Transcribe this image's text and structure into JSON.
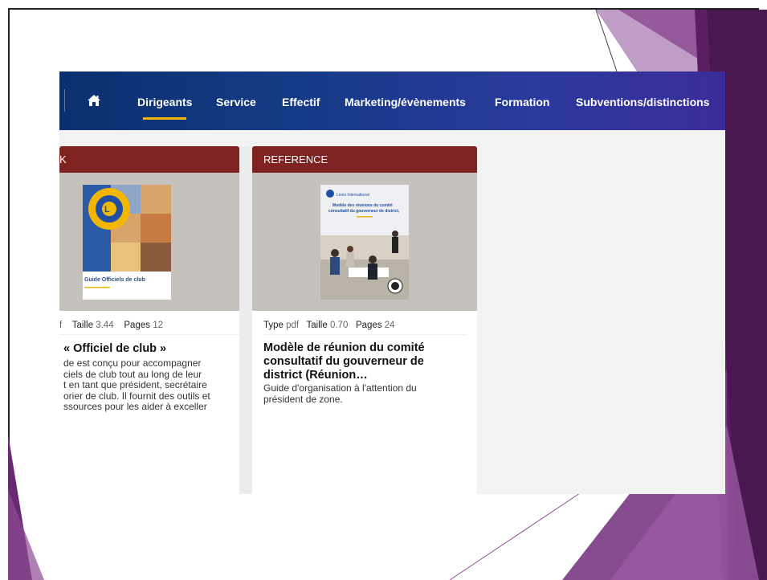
{
  "nav": {
    "items": [
      "Dirigeants",
      "Service",
      "Effectif",
      "Marketing/évènements",
      "Formation",
      "Subventions/distinctions"
    ],
    "active": "Dirigeants"
  },
  "colors": {
    "nav_start": "#0b2f6e",
    "nav_end": "#3b2c9a",
    "active_underline": "#f2b705",
    "card_header": "#7f2322",
    "deco_purple": "#6a2a73"
  },
  "cards": [
    {
      "header": "K",
      "cover_title": "Guide Officiels de club",
      "cover_logo": "LIONS INTERNATIONAL",
      "meta_type_value": "f",
      "meta_size_label": "Taille",
      "meta_size_value": "3.44",
      "meta_pages_label": "Pages",
      "meta_pages_value": "12",
      "title": "« Officiel de club »",
      "desc": [
        "de est conçu pour accompagner",
        "ciels de club tout au long de leur",
        "t en tant que président, secrétaire",
        "orier de club. Il fournit des outils et",
        "ssources pour les aider à exceller"
      ]
    },
    {
      "header": "REFERENCE",
      "cover_brand": "Lions International",
      "cover_title": "Modèle des réunions du comité consultatif du gouverneur de district,",
      "meta_type_label": "Type",
      "meta_type_value": "pdf",
      "meta_size_label": "Taille",
      "meta_size_value": "0.70",
      "meta_pages_label": "Pages",
      "meta_pages_value": "24",
      "title": [
        "Modèle de réunion du comité",
        "consultatif du gouverneur de",
        "district (Réunion…"
      ],
      "desc": [
        "Guide d'organisation à l'attention du",
        "président de zone."
      ]
    }
  ]
}
